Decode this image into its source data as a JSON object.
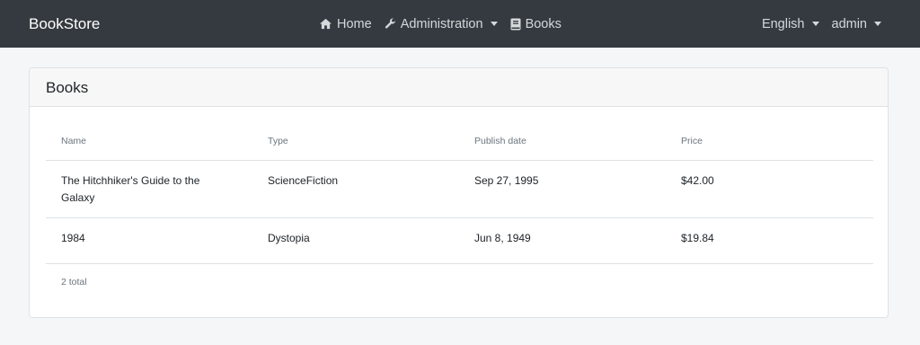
{
  "navbar": {
    "brand": "BookStore",
    "items": [
      {
        "label": "Home",
        "icon": "home-icon"
      },
      {
        "label": "Administration",
        "icon": "wrench-icon"
      },
      {
        "label": "Books",
        "icon": "book-icon"
      }
    ],
    "language": "English",
    "user": "admin"
  },
  "card": {
    "title": "Books",
    "columns": [
      "Name",
      "Type",
      "Publish date",
      "Price"
    ],
    "rows": [
      {
        "name": "The Hitchhiker's Guide to the Galaxy",
        "type": "ScienceFiction",
        "publish_date": "Sep 27, 1995",
        "price": "$42.00"
      },
      {
        "name": "1984",
        "type": "Dystopia",
        "publish_date": "Jun 8, 1949",
        "price": "$19.84"
      }
    ],
    "total": "2 total"
  },
  "colors": {
    "navbar_bg": "#343a40",
    "page_bg": "#f4f6f8",
    "card_header_bg": "#f7f7f7"
  }
}
